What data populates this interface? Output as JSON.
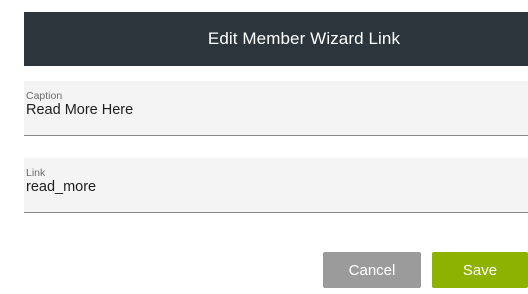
{
  "dialog": {
    "title": "Edit Member Wizard Link"
  },
  "fields": {
    "caption": {
      "label": "Caption",
      "value": "Read More Here"
    },
    "link": {
      "label": "Link",
      "value": "read_more"
    }
  },
  "actions": {
    "cancel_label": "Cancel",
    "save_label": "Save"
  },
  "colors": {
    "header_bg": "#2b353b",
    "save_green": "#8db200",
    "cancel_gray": "#9b9b9b",
    "field_bg": "#f4f4f4"
  }
}
